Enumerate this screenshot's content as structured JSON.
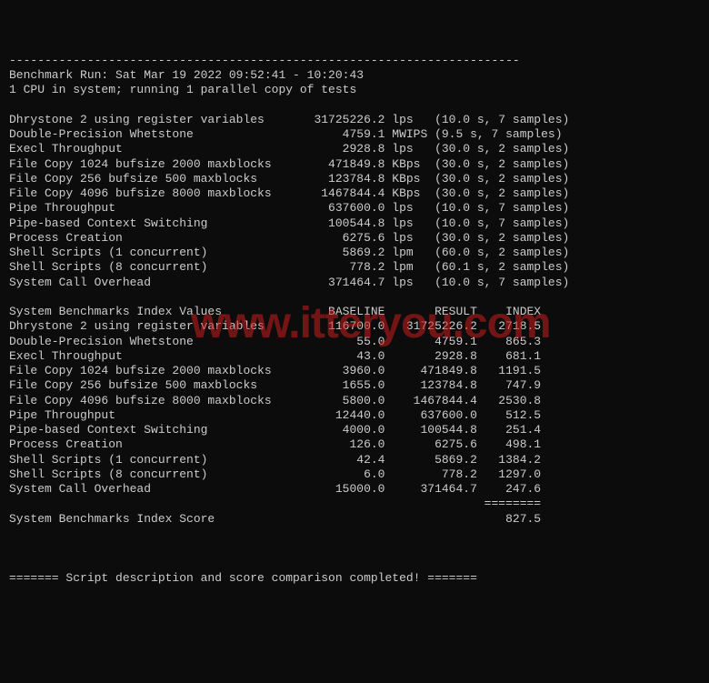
{
  "watermark": "www.itteryou.com",
  "sep_line": "------------------------------------------------------------------------",
  "run_header": "Benchmark Run: Sat Mar 19 2022 09:52:41 - 10:20:43",
  "cpu_info": "1 CPU in system; running 1 parallel copy of tests",
  "raw_block": "Dhrystone 2 using register variables       31725226.2 lps   (10.0 s, 7 samples)\nDouble-Precision Whetstone                     4759.1 MWIPS (9.5 s, 7 samples)\nExecl Throughput                               2928.8 lps   (30.0 s, 2 samples)\nFile Copy 1024 bufsize 2000 maxblocks        471849.8 KBps  (30.0 s, 2 samples)\nFile Copy 256 bufsize 500 maxblocks          123784.8 KBps  (30.0 s, 2 samples)\nFile Copy 4096 bufsize 8000 maxblocks       1467844.4 KBps  (30.0 s, 2 samples)\nPipe Throughput                              637600.0 lps   (10.0 s, 7 samples)\nPipe-based Context Switching                 100544.8 lps   (10.0 s, 7 samples)\nProcess Creation                               6275.6 lps   (30.0 s, 2 samples)\nShell Scripts (1 concurrent)                   5869.2 lpm   (60.0 s, 2 samples)\nShell Scripts (8 concurrent)                    778.2 lpm   (60.1 s, 2 samples)\nSystem Call Overhead                         371464.7 lps   (10.0 s, 7 samples)",
  "index_header": "System Benchmarks Index Values               BASELINE       RESULT    INDEX",
  "index_block": "Dhrystone 2 using register variables         116700.0   31725226.2   2718.5\nDouble-Precision Whetstone                       55.0       4759.1    865.3\nExecl Throughput                                 43.0       2928.8    681.1\nFile Copy 1024 bufsize 2000 maxblocks          3960.0     471849.8   1191.5\nFile Copy 256 bufsize 500 maxblocks            1655.0     123784.8    747.9\nFile Copy 4096 bufsize 8000 maxblocks          5800.0    1467844.4   2530.8\nPipe Throughput                               12440.0     637600.0    512.5\nPipe-based Context Switching                   4000.0     100544.8    251.4\nProcess Creation                                126.0       6275.6    498.1\nShell Scripts (1 concurrent)                     42.4       5869.2   1384.2\nShell Scripts (8 concurrent)                      6.0        778.2   1297.0\nSystem Call Overhead                          15000.0     371464.7    247.6",
  "index_sep": "                                                                   ========",
  "index_score": "System Benchmarks Index Score                                         827.5",
  "footer": "======= Script description and score comparison completed! ======="
}
